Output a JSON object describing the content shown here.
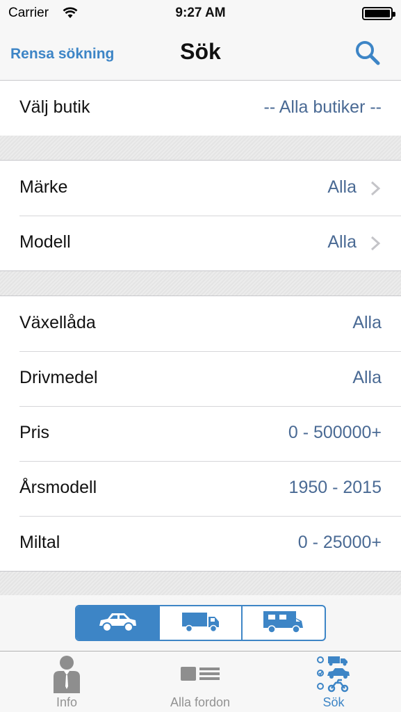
{
  "status_bar": {
    "carrier": "Carrier",
    "time": "9:27 AM"
  },
  "nav": {
    "left_button": "Rensa sökning",
    "title": "Sök",
    "right_icon": "search-icon"
  },
  "sections": [
    {
      "rows": [
        {
          "label": "Välj butik",
          "value": "-- Alla butiker --",
          "chevron": false
        }
      ]
    },
    {
      "rows": [
        {
          "label": "Märke",
          "value": "Alla",
          "chevron": true
        },
        {
          "label": "Modell",
          "value": "Alla",
          "chevron": true
        }
      ]
    },
    {
      "rows": [
        {
          "label": "Växellåda",
          "value": "Alla",
          "chevron": false
        },
        {
          "label": "Drivmedel",
          "value": "Alla",
          "chevron": false
        },
        {
          "label": "Pris",
          "value": "0 - 500000+",
          "chevron": false
        },
        {
          "label": "Årsmodell",
          "value": "1950 - 2015",
          "chevron": false
        },
        {
          "label": "Miltal",
          "value": "0 - 25000+",
          "chevron": false
        }
      ]
    }
  ],
  "vehicle_segment": {
    "options": [
      "car-icon",
      "truck-icon",
      "camper-icon"
    ],
    "selected": "car-icon"
  },
  "tabbar": {
    "tabs": [
      {
        "label": "Info",
        "icon": "person-icon",
        "active": false
      },
      {
        "label": "Alla fordon",
        "icon": "list-icon",
        "active": false
      },
      {
        "label": "Sök",
        "icon": "search-vehicles-icon",
        "active": true
      }
    ]
  },
  "colors": {
    "accent": "#3d85c6",
    "value_text": "#4a6a94",
    "background": "#e8e8e8"
  }
}
